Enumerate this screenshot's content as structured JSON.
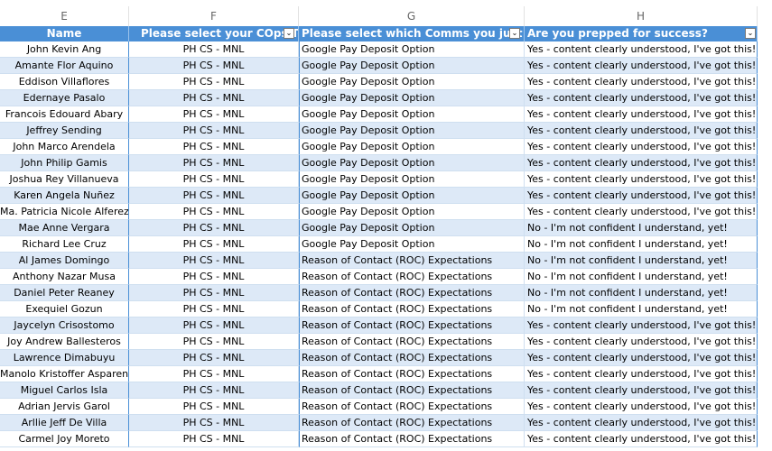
{
  "column_letters": [
    "E",
    "F",
    "G",
    "H"
  ],
  "headers": {
    "name": "Name",
    "team": "Please select your COps Team",
    "comms": "Please select which Comms you just read:",
    "prepped": "Are you prepped for success?"
  },
  "dropdown_glyph": "⌄",
  "colors": {
    "header_bg": "#4a8fd6",
    "band_bg": "#dde9f7",
    "grid": "#cfdff0"
  },
  "rows": [
    {
      "name": "John Kevin Ang",
      "team": "PH CS - MNL",
      "comms": "Google Pay Deposit Option",
      "prepped": "Yes - content clearly understood, I've got this!"
    },
    {
      "name": "Amante Flor Aquino",
      "team": "PH CS - MNL",
      "comms": "Google Pay Deposit Option",
      "prepped": "Yes - content clearly understood, I've got this!"
    },
    {
      "name": "Eddison Villaflores",
      "team": "PH CS - MNL",
      "comms": "Google Pay Deposit Option",
      "prepped": "Yes - content clearly understood, I've got this!"
    },
    {
      "name": "Edernaye Pasalo",
      "team": "PH CS - MNL",
      "comms": "Google Pay Deposit Option",
      "prepped": "Yes - content clearly understood, I've got this!"
    },
    {
      "name": "Francois Edouard Abary",
      "team": "PH CS - MNL",
      "comms": "Google Pay Deposit Option",
      "prepped": "Yes - content clearly understood, I've got this!"
    },
    {
      "name": "Jeffrey Sending",
      "team": "PH CS - MNL",
      "comms": "Google Pay Deposit Option",
      "prepped": "Yes - content clearly understood, I've got this!"
    },
    {
      "name": "John Marco Arendela",
      "team": "PH CS - MNL",
      "comms": "Google Pay Deposit Option",
      "prepped": "Yes - content clearly understood, I've got this!"
    },
    {
      "name": "John Philip Gamis",
      "team": "PH CS - MNL",
      "comms": "Google Pay Deposit Option",
      "prepped": "Yes - content clearly understood, I've got this!"
    },
    {
      "name": "Joshua Rey Villanueva",
      "team": "PH CS - MNL",
      "comms": "Google Pay Deposit Option",
      "prepped": "Yes - content clearly understood, I've got this!"
    },
    {
      "name": "Karen Angela Nuñez",
      "team": "PH CS - MNL",
      "comms": "Google Pay Deposit Option",
      "prepped": "Yes - content clearly understood, I've got this!"
    },
    {
      "name": "Ma. Patricia Nicole Alferez",
      "team": "PH CS - MNL",
      "comms": "Google Pay Deposit Option",
      "prepped": "Yes - content clearly understood, I've got this!"
    },
    {
      "name": "Mae Anne Vergara",
      "team": "PH CS - MNL",
      "comms": "Google Pay Deposit Option",
      "prepped": "No - I'm not confident I understand, yet!"
    },
    {
      "name": "Richard Lee Cruz",
      "team": "PH CS - MNL",
      "comms": "Google Pay Deposit Option",
      "prepped": "No - I'm not confident I understand, yet!"
    },
    {
      "name": "Al James Domingo",
      "team": "PH CS - MNL",
      "comms": "Reason of Contact (ROC) Expectations",
      "prepped": "No - I'm not confident I understand, yet!"
    },
    {
      "name": "Anthony Nazar Musa",
      "team": "PH CS - MNL",
      "comms": "Reason of Contact (ROC) Expectations",
      "prepped": "No - I'm not confident I understand, yet!"
    },
    {
      "name": "Daniel Peter Reaney",
      "team": "PH CS - MNL",
      "comms": "Reason of Contact (ROC) Expectations",
      "prepped": "No - I'm not confident I understand, yet!"
    },
    {
      "name": "Exequiel Gozun",
      "team": "PH CS - MNL",
      "comms": "Reason of Contact (ROC) Expectations",
      "prepped": "No - I'm not confident I understand, yet!"
    },
    {
      "name": "Jaycelyn Crisostomo",
      "team": "PH CS - MNL",
      "comms": "Reason of Contact (ROC) Expectations",
      "prepped": "Yes - content clearly understood, I've got this!"
    },
    {
      "name": "Joy Andrew Ballesteros",
      "team": "PH CS - MNL",
      "comms": "Reason of Contact (ROC) Expectations",
      "prepped": "Yes - content clearly understood, I've got this!"
    },
    {
      "name": "Lawrence Dimabuyu",
      "team": "PH CS - MNL",
      "comms": "Reason of Contact (ROC) Expectations",
      "prepped": "Yes - content clearly understood, I've got this!"
    },
    {
      "name": "Manolo Kristoffer Asparen",
      "team": "PH CS - MNL",
      "comms": "Reason of Contact (ROC) Expectations",
      "prepped": "Yes - content clearly understood, I've got this!"
    },
    {
      "name": "Miguel Carlos Isla",
      "team": "PH CS - MNL",
      "comms": "Reason of Contact (ROC) Expectations",
      "prepped": "Yes - content clearly understood, I've got this!"
    },
    {
      "name": "Adrian Jervis Garol",
      "team": "PH CS - MNL",
      "comms": "Reason of Contact (ROC) Expectations",
      "prepped": "Yes - content clearly understood, I've got this!"
    },
    {
      "name": "Arllie Jeff De Villa",
      "team": "PH CS - MNL",
      "comms": "Reason of Contact (ROC) Expectations",
      "prepped": "Yes - content clearly understood, I've got this!"
    },
    {
      "name": "Carmel Joy Moreto",
      "team": "PH CS - MNL",
      "comms": "Reason of Contact (ROC) Expectations",
      "prepped": "Yes - content clearly understood, I've got this!"
    }
  ]
}
